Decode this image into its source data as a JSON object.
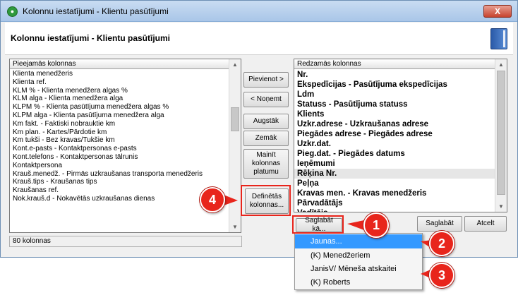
{
  "window": {
    "title": "Kolonnu iestatījumi - Klientu pasūtījumi",
    "close_label": "X"
  },
  "header": {
    "title": "Kolonnu iestatījumi - Klientu pasūtījumi"
  },
  "left_list": {
    "header": "Pieejamās kolonnas",
    "items": [
      "Klienta menedžeris",
      "Klienta ref.",
      "KLM % - Klienta menedžera algas %",
      "KLM alga - Klienta menedžera alga",
      "KLPM % - Klienta pasūtījuma menedžera algas %",
      "KLPM alga - Klienta pasūtījuma menedžera alga",
      "Km fakt. - Faktiski nobrauktie km",
      "Km plan. - Kartes/Pārdotie km",
      "Km tukši - Bez kravas/Tukšie km",
      "Kont.e-pasts - Kontaktpersonas e-pasts",
      "Kont.telefons - Kontaktpersonas tālrunis",
      "Kontaktpersona",
      "Krauš.menedž. - Pirmās uzkraušanas transporta menedžeris",
      "Krauš.tips - Kraušanas tips",
      "Kraušanas ref.",
      "Nok.krauš.d - Nokavētās uzkraušanas dienas"
    ]
  },
  "right_list": {
    "header": "Redzamās kolonnas",
    "items": [
      "Nr.",
      "Ekspedīcijas - Pasūtījuma ekspedīcijas",
      "Ldm",
      "Statuss - Pasūtījuma statuss",
      "Klients",
      "Uzkr.adrese - Uzkraušanas adrese",
      "Piegādes adrese - Piegādes adrese",
      "Uzkr.dat.",
      "Pieg.dat. - Piegādes datums",
      "Ieņēmumi",
      "Rēķina Nr.",
      "Peļņa",
      "Kravas men. - Kravas menedžeris",
      "Pārvadātājs",
      "Vadītājs"
    ]
  },
  "buttons": {
    "add": "Pievienot >",
    "remove": "< Noņemt",
    "up": "Augstāk",
    "down": "Zemāk",
    "width_line1": "Mainīt",
    "width_line2": "kolonnas",
    "width_line3": "platumu",
    "defined_line1": "Definētās",
    "defined_line2": "kolonnas...",
    "save_as": "Saglabāt kā...",
    "save": "Saglabāt",
    "cancel": "Atcelt"
  },
  "status": {
    "count": "80 kolonnas"
  },
  "dropdown": {
    "items": [
      "Jaunas...",
      "(K) Menedžeriem",
      "JanisV/ Mēneša atskaitei",
      "(K) Roberts"
    ]
  },
  "callouts": [
    "1",
    "2",
    "3",
    "4"
  ],
  "colors": {
    "callout_red": "#e8251c",
    "highlight_blue": "#3399ff"
  }
}
